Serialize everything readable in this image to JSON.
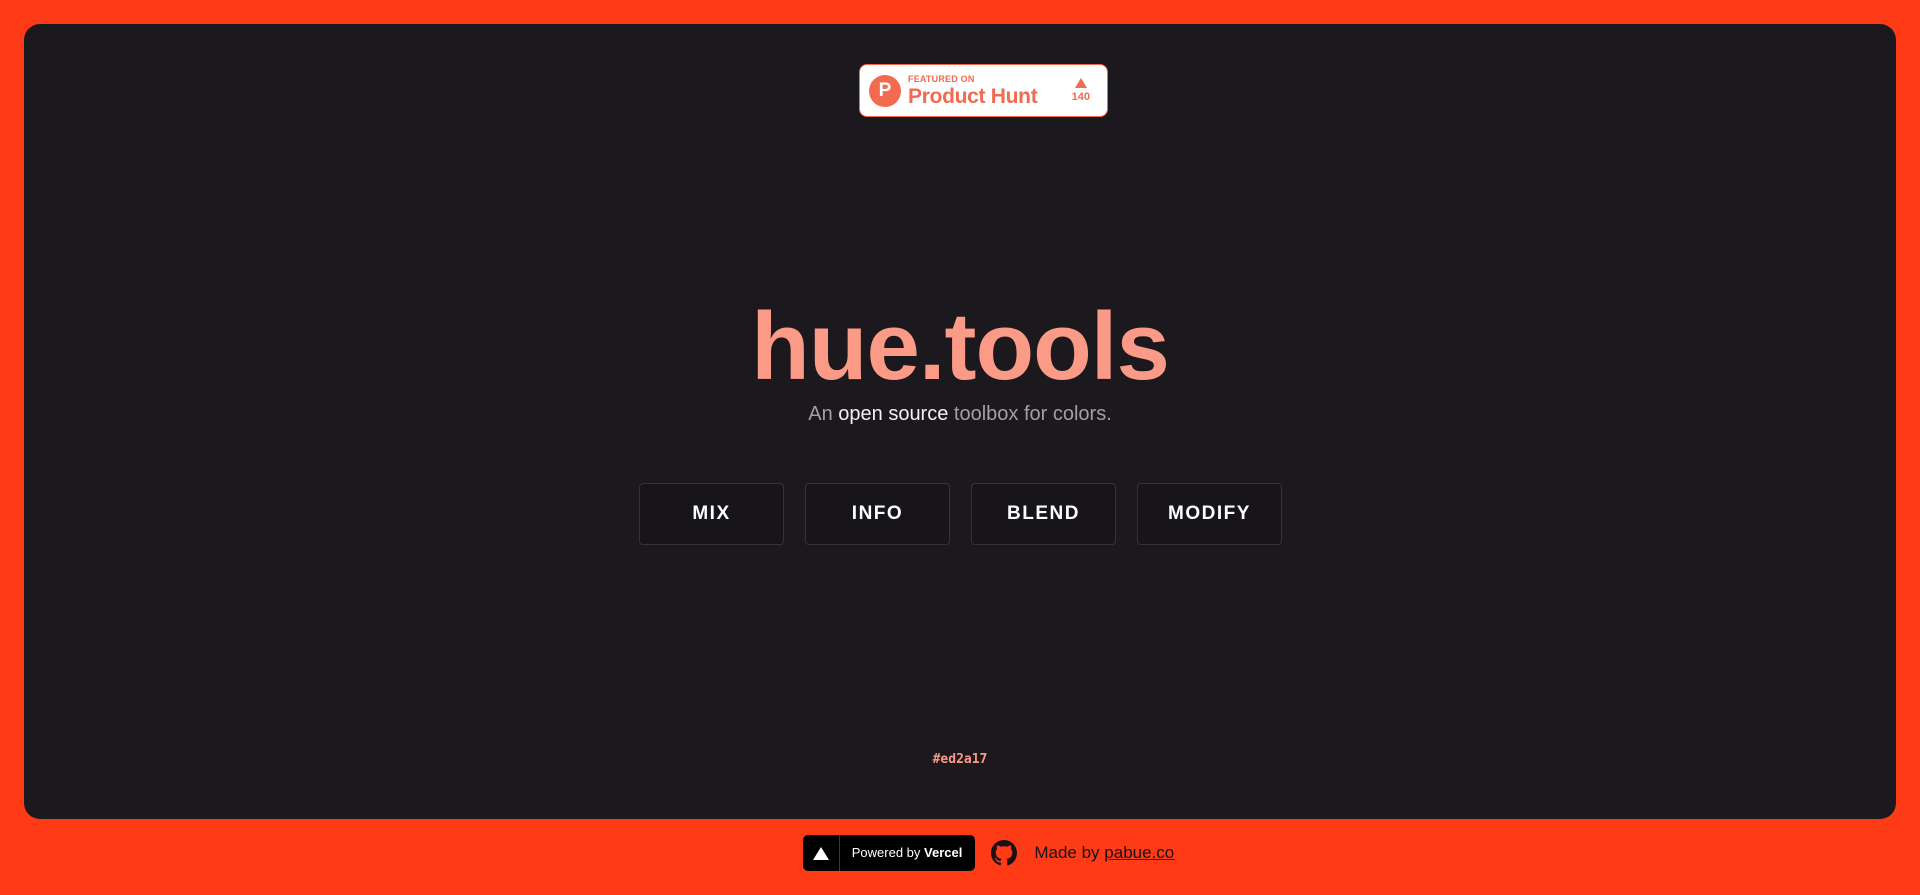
{
  "product_hunt": {
    "featured_label": "FEATURED ON",
    "name": "Product Hunt",
    "logo_letter": "P",
    "votes": "140",
    "icon_arrow": "upvote-arrow-icon",
    "color": "#f26a50"
  },
  "hero": {
    "title": "hue.tools",
    "subtitle_prefix": "An ",
    "subtitle_strong": "open source",
    "subtitle_suffix": " toolbox for colors."
  },
  "tools": [
    {
      "label": "MIX"
    },
    {
      "label": "INFO"
    },
    {
      "label": "BLEND"
    },
    {
      "label": "MODIFY"
    }
  ],
  "current_color": "#ed2a17",
  "footer": {
    "vercel_prefix": "Powered by ",
    "vercel_brand": "Vercel",
    "made_by_prefix": "Made by ",
    "made_by_link": "pabue.co",
    "github_icon": "github-icon"
  },
  "colors": {
    "page_background": "#ff3a16",
    "card_background": "#1c191e",
    "accent": "#fb9a86"
  }
}
